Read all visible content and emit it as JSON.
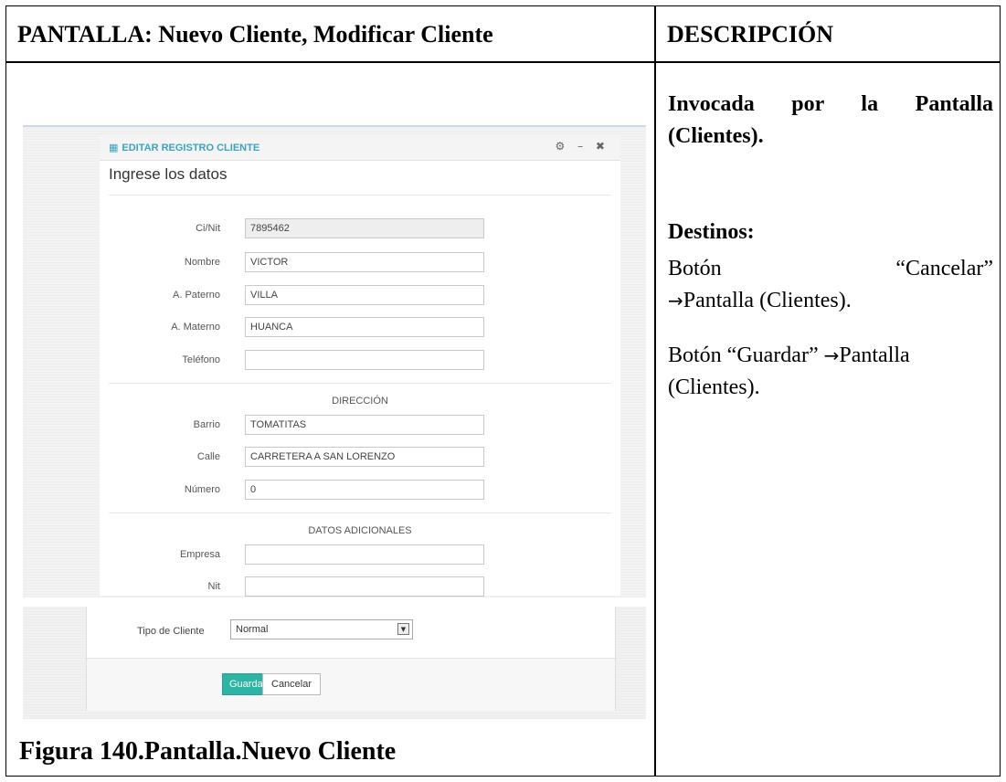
{
  "document": {
    "header_left": "PANTALLA: Nuevo Cliente, Modificar Cliente",
    "header_right": "DESCRIPCIÓN",
    "caption": "Figura 140.Pantalla.Nuevo Cliente",
    "description": {
      "intro": "Invocada por la Pantalla (Clientes).",
      "destinos_title": "Destinos:",
      "p1_word1": "Botón",
      "p1_word2": "“Cancelar”",
      "p1_line2": "Pantalla (Clientes).",
      "p2_line1": "Botón “Guardar”",
      "p2_line1_end": "Pantalla",
      "p2_line2": "(Clientes).",
      "arrow": "→"
    }
  },
  "form": {
    "panel_title": "EDITAR REGISTRO CLIENTE",
    "panel_tools": "⚙ – ✖",
    "subtitle": "Ingrese los datos",
    "fields": [
      {
        "label": "Ci/Nit",
        "value": "7895462"
      },
      {
        "label": "Nombre",
        "value": "VICTOR"
      },
      {
        "label": "A. Paterno",
        "value": "VILLA"
      },
      {
        "label": "A. Materno",
        "value": "HUANCA"
      },
      {
        "label": "Teléfono",
        "value": ""
      }
    ],
    "direccion_title": "DIRECCIÓN",
    "direccion_fields": [
      {
        "label": "Barrio",
        "value": "TOMATITAS"
      },
      {
        "label": "Calle",
        "value": "CARRETERA A SAN LORENZO"
      },
      {
        "label": "Número",
        "value": "0"
      }
    ],
    "adicionales_title": "DATOS ADICIONALES",
    "adicionales_fields": [
      {
        "label": "Empresa",
        "value": ""
      },
      {
        "label": "Nit",
        "value": ""
      }
    ],
    "tipo_label": "Tipo de Cliente",
    "tipo_value": "Normal",
    "save_label": "Guardar",
    "cancel_label": "Cancelar"
  }
}
